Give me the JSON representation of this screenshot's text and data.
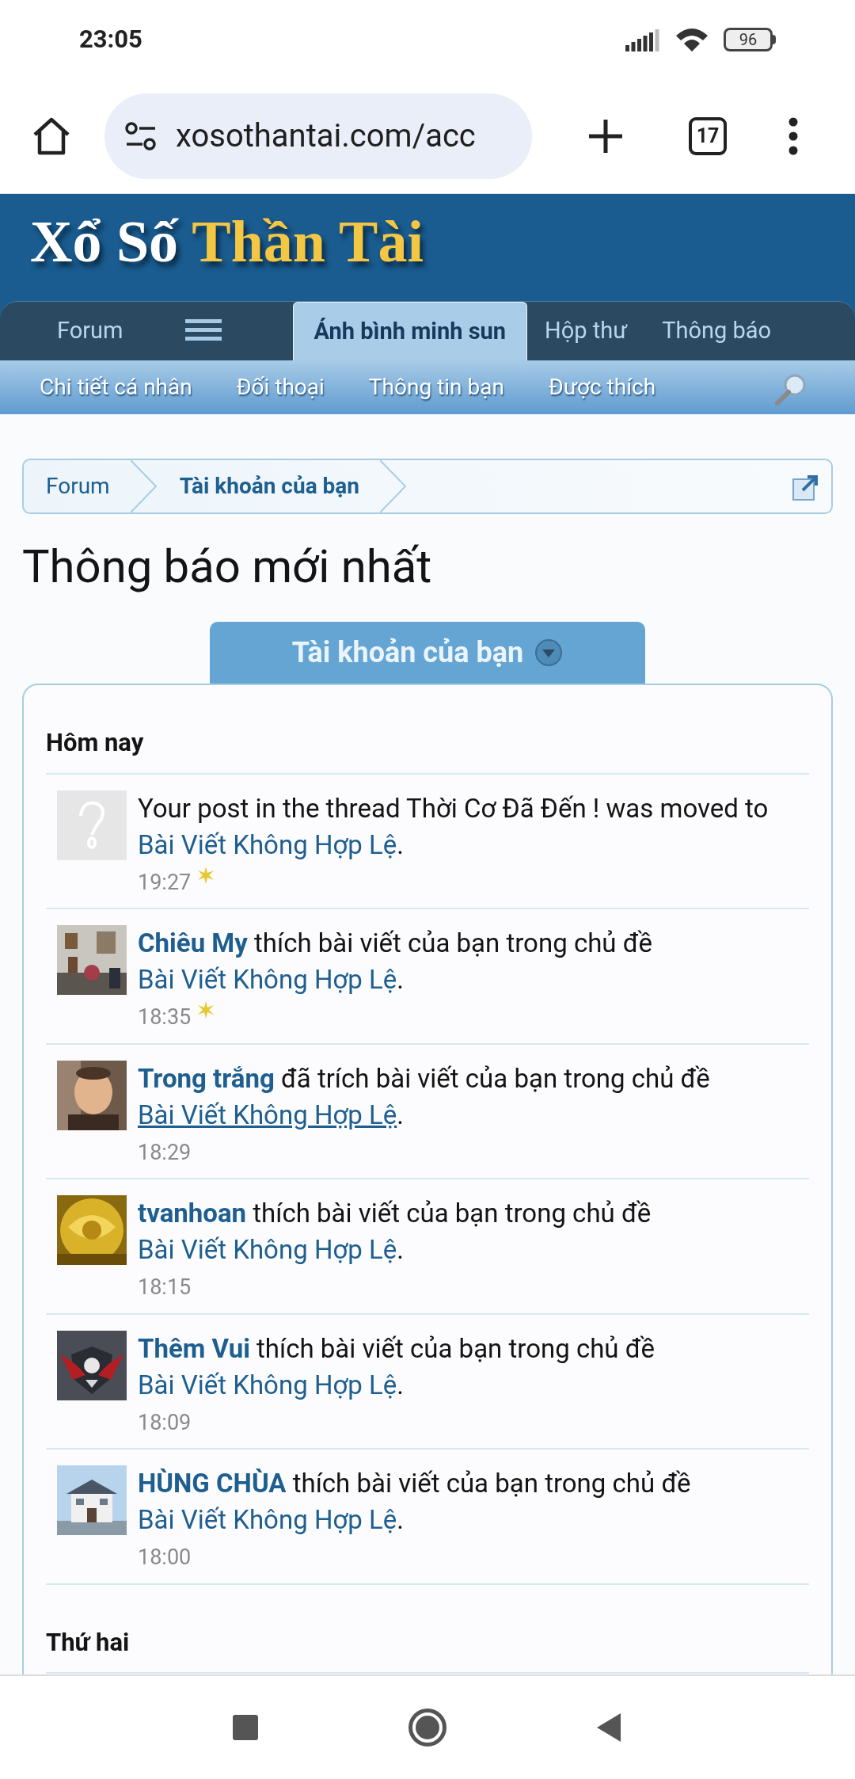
{
  "status_bar": {
    "time": "23:05",
    "battery": "96"
  },
  "browser": {
    "url": "xosothantai.com/acc",
    "tab_count": "17"
  },
  "site": {
    "logo_white": "Xổ Số",
    "logo_gold": "Thần Tài"
  },
  "tabs": [
    {
      "label": "Forum",
      "selected": false
    },
    {
      "label": "Ánh bình minh sun",
      "selected": true
    },
    {
      "label": "Hộp thư",
      "selected": false
    },
    {
      "label": "Thông báo",
      "selected": false
    }
  ],
  "subnav": [
    "Chi tiết cá nhân",
    "Đối thoại",
    "Thông tin bạn",
    "Được thích"
  ],
  "breadcrumb": [
    {
      "label": "Forum",
      "current": false
    },
    {
      "label": "Tài khoản của bạn",
      "current": true
    }
  ],
  "title": "Thông báo mới nhất",
  "section_tab": "Tài khoản của bạn",
  "groups": [
    {
      "heading": "Hôm nay",
      "items": [
        {
          "kind": "placeholder",
          "text": "Your post in the thread Thời Cơ Đã Đến ! was moved to ",
          "link": "Bài Viết Không Hợp Lệ",
          "link_underlined": false,
          "end": ".",
          "time": "19:27",
          "new": true
        },
        {
          "kind": "picture",
          "user": "Chiêu My",
          "text": " thích bài viết của bạn trong chủ đề ",
          "link": "Bài Viết Không Hợp Lệ",
          "link_underlined": false,
          "end": ".",
          "time": "18:35",
          "new": true
        },
        {
          "kind": "picture",
          "user": "Trong trắng",
          "text": " đã trích bài viết của bạn trong chủ đề ",
          "link": "Bài Viết Không Hợp Lệ",
          "link_underlined": true,
          "end": ".",
          "time": "18:29",
          "new": false
        },
        {
          "kind": "picture",
          "user": "tvanhoan",
          "text": " thích bài viết của bạn trong chủ đề ",
          "link": "Bài Viết Không Hợp Lệ",
          "link_underlined": false,
          "end": ".",
          "time": "18:15",
          "new": false
        },
        {
          "kind": "picture",
          "user": "Thêm Vui",
          "text": " thích bài viết của bạn trong chủ đề ",
          "link": "Bài Viết Không Hợp Lệ",
          "link_underlined": false,
          "end": ".",
          "time": "18:09",
          "new": false
        },
        {
          "kind": "picture",
          "user": "HÙNG CHÙA",
          "text": " thích bài viết của bạn trong chủ đề ",
          "link": "Bài Viết Không Hợp Lệ",
          "link_underlined": false,
          "end": ".",
          "time": "18:00",
          "new": false
        }
      ]
    },
    {
      "heading": "Thứ hai"
    }
  ]
}
